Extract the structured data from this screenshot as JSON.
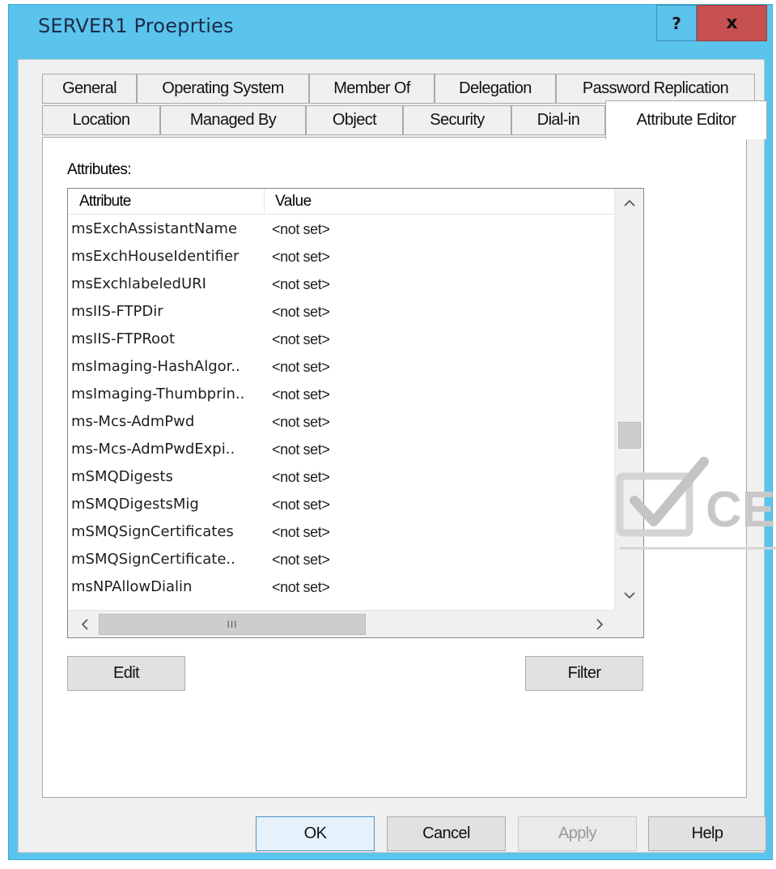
{
  "window": {
    "title": "SERVER1 Proeprties",
    "help_label": "?",
    "close_label": "x"
  },
  "tabs_row1": [
    "General",
    "Operating System",
    "Member Of",
    "Delegation",
    "Password Replication"
  ],
  "tabs_row2": [
    "Location",
    "Managed By",
    "Object",
    "Security",
    "Dial-in",
    "Attribute Editor"
  ],
  "active_tab": "Attribute Editor",
  "attributes_label": "Attributes:",
  "list": {
    "columns": [
      "Attribute",
      "Value"
    ],
    "rows": [
      {
        "attribute": "msExchAssistantName",
        "value": "<not set>"
      },
      {
        "attribute": "msExchHouseIdentifier",
        "value": "<not set>"
      },
      {
        "attribute": "msExchlabeledURI",
        "value": "<not set>"
      },
      {
        "attribute": "msIIS-FTPDir",
        "value": "<not set>"
      },
      {
        "attribute": "msIIS-FTPRoot",
        "value": "<not set>"
      },
      {
        "attribute": "msImaging-HashAlgor..",
        "value": "<not set>"
      },
      {
        "attribute": "msImaging-Thumbprin..",
        "value": "<not set>"
      },
      {
        "attribute": "ms-Mcs-AdmPwd",
        "value": "<not set>"
      },
      {
        "attribute": "ms-Mcs-AdmPwdExpi..",
        "value": "<not set>"
      },
      {
        "attribute": "mSMQDigests",
        "value": "<not set>"
      },
      {
        "attribute": "mSMQDigestsMig",
        "value": "<not set>"
      },
      {
        "attribute": "mSMQSignCertificates",
        "value": "<not set>"
      },
      {
        "attribute": "mSMQSignCertificate..",
        "value": "<not set>"
      },
      {
        "attribute": "msNPAllowDialin",
        "value": "<not set>"
      }
    ],
    "hscroll_thumb_label": "III"
  },
  "buttons": {
    "edit": "Edit",
    "filter": "Filter",
    "ok": "OK",
    "cancel": "Cancel",
    "apply": "Apply",
    "help": "Help"
  },
  "watermark_text": "CE"
}
